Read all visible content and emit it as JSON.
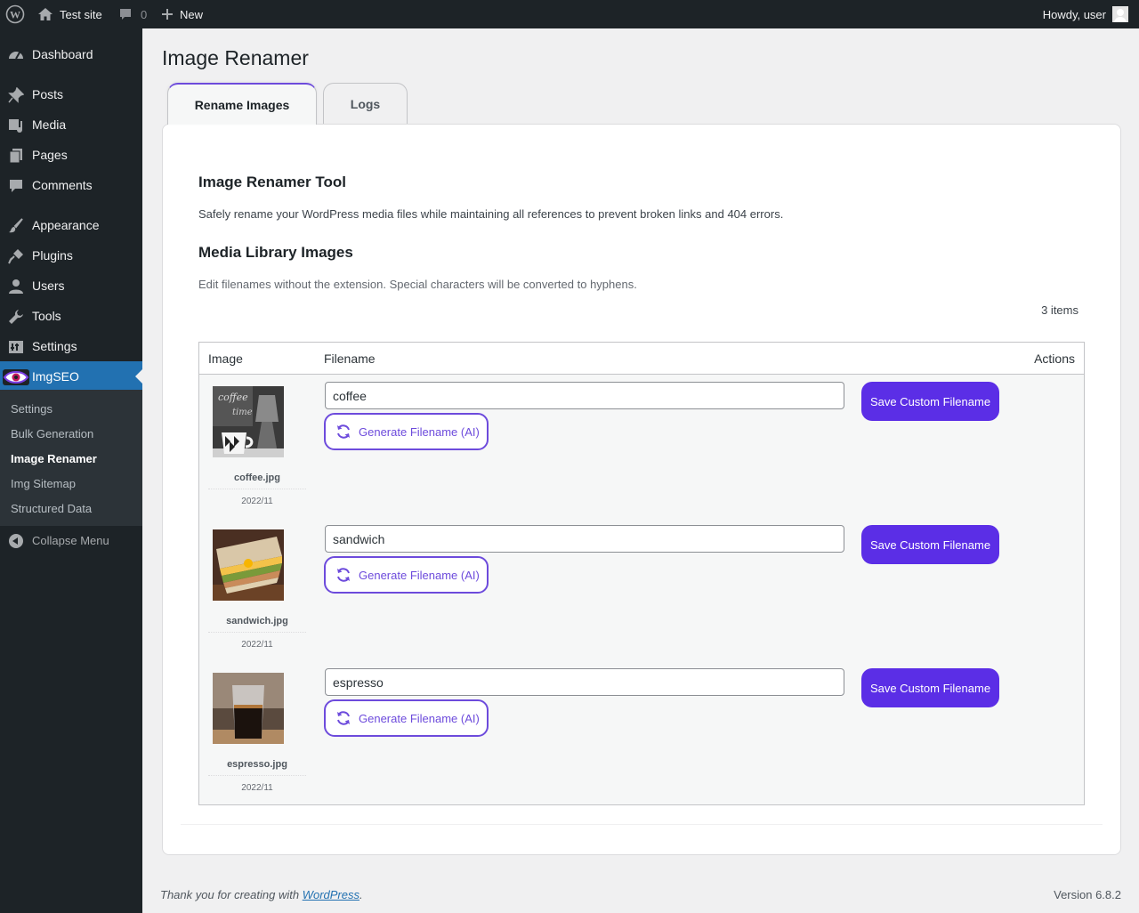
{
  "adminbar": {
    "site_name": "Test site",
    "comments_count": "0",
    "new_label": "New",
    "howdy": "Howdy, user"
  },
  "sidebar": {
    "items": [
      {
        "label": "Dashboard",
        "icon": "dashboard-icon"
      },
      {
        "label": "Posts",
        "icon": "pin-icon"
      },
      {
        "label": "Media",
        "icon": "media-icon"
      },
      {
        "label": "Pages",
        "icon": "pages-icon"
      },
      {
        "label": "Comments",
        "icon": "comment-icon"
      },
      {
        "label": "Appearance",
        "icon": "brush-icon"
      },
      {
        "label": "Plugins",
        "icon": "plug-icon"
      },
      {
        "label": "Users",
        "icon": "user-icon"
      },
      {
        "label": "Tools",
        "icon": "wrench-icon"
      },
      {
        "label": "Settings",
        "icon": "settings-icon"
      },
      {
        "label": "ImgSEO",
        "icon": "eye-logo-icon"
      }
    ],
    "submenu": [
      "Settings",
      "Bulk Generation",
      "Image Renamer",
      "Img Sitemap",
      "Structured Data"
    ],
    "collapse_label": "Collapse Menu",
    "accent_color": "#2271b1"
  },
  "page": {
    "title": "Image Renamer",
    "tabs": [
      {
        "label": "Rename Images",
        "active": true
      },
      {
        "label": "Logs",
        "active": false
      }
    ],
    "tool_heading": "Image Renamer Tool",
    "tool_desc": "Safely rename your WordPress media files while maintaining all references to prevent broken links and 404 errors.",
    "library_heading": "Media Library Images",
    "library_desc": "Edit filenames without the extension. Special characters will be converted to hyphens.",
    "items_count": "3 items",
    "brand_color": "#5b2ee6"
  },
  "table": {
    "columns": [
      "Image",
      "Filename",
      "Actions"
    ],
    "rows": [
      {
        "file": "coffee.jpg",
        "date": "2022/11",
        "value": "coffee",
        "generate_label": "Generate Filename (AI)",
        "save_label": "Save Custom Filename"
      },
      {
        "file": "sandwich.jpg",
        "date": "2022/11",
        "value": "sandwich",
        "generate_label": "Generate Filename (AI)",
        "save_label": "Save Custom Filename"
      },
      {
        "file": "espresso.jpg",
        "date": "2022/11",
        "value": "espresso",
        "generate_label": "Generate Filename (AI)",
        "save_label": "Save Custom Filename"
      }
    ]
  },
  "footer": {
    "thanks_prefix": "Thank you for creating with ",
    "thanks_link": "WordPress",
    "thanks_suffix": ".",
    "version": "Version 6.8.2"
  }
}
